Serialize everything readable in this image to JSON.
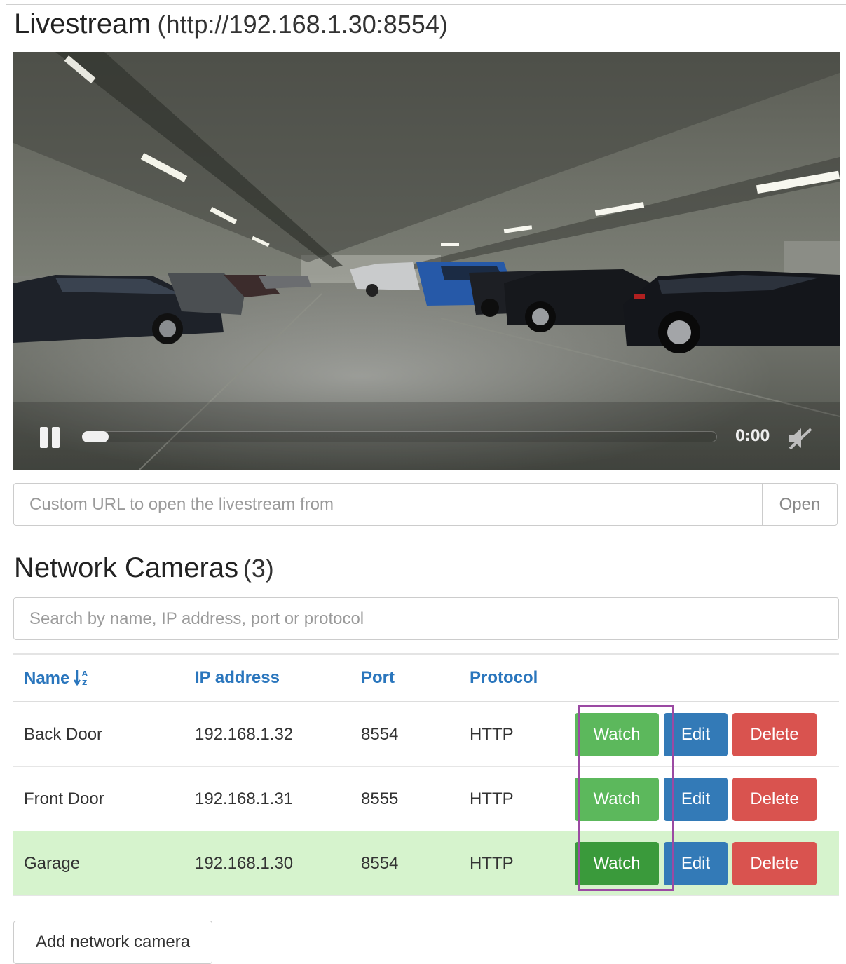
{
  "livestream": {
    "title": "Livestream",
    "url": "(http://192.168.1.30:8554)",
    "player": {
      "time": "0:00",
      "progress": 0.04,
      "state": "playing",
      "muted": true
    }
  },
  "url_form": {
    "placeholder": "Custom URL to open the livestream from",
    "open_label": "Open"
  },
  "cameras": {
    "title": "Network Cameras",
    "count": "(3)",
    "search_placeholder": "Search by name, IP address, port or protocol",
    "columns": [
      "Name",
      "IP address",
      "Port",
      "Protocol"
    ],
    "rows": [
      {
        "name": "Back Door",
        "ip": "192.168.1.32",
        "port": "8554",
        "protocol": "HTTP",
        "active": false
      },
      {
        "name": "Front Door",
        "ip": "192.168.1.31",
        "port": "8555",
        "protocol": "HTTP",
        "active": false
      },
      {
        "name": "Garage",
        "ip": "192.168.1.30",
        "port": "8554",
        "protocol": "HTTP",
        "active": true
      }
    ],
    "actions": {
      "watch": "Watch",
      "edit": "Edit",
      "delete": "Delete"
    },
    "add_label": "Add network camera"
  },
  "colors": {
    "header_link": "#2a76bd",
    "watch": "#5cb85c",
    "watch_active": "#3a9a3b",
    "edit": "#337ab7",
    "delete": "#d9534f",
    "active_row": "#d6f3cd",
    "highlight": "#9b4aa3"
  }
}
